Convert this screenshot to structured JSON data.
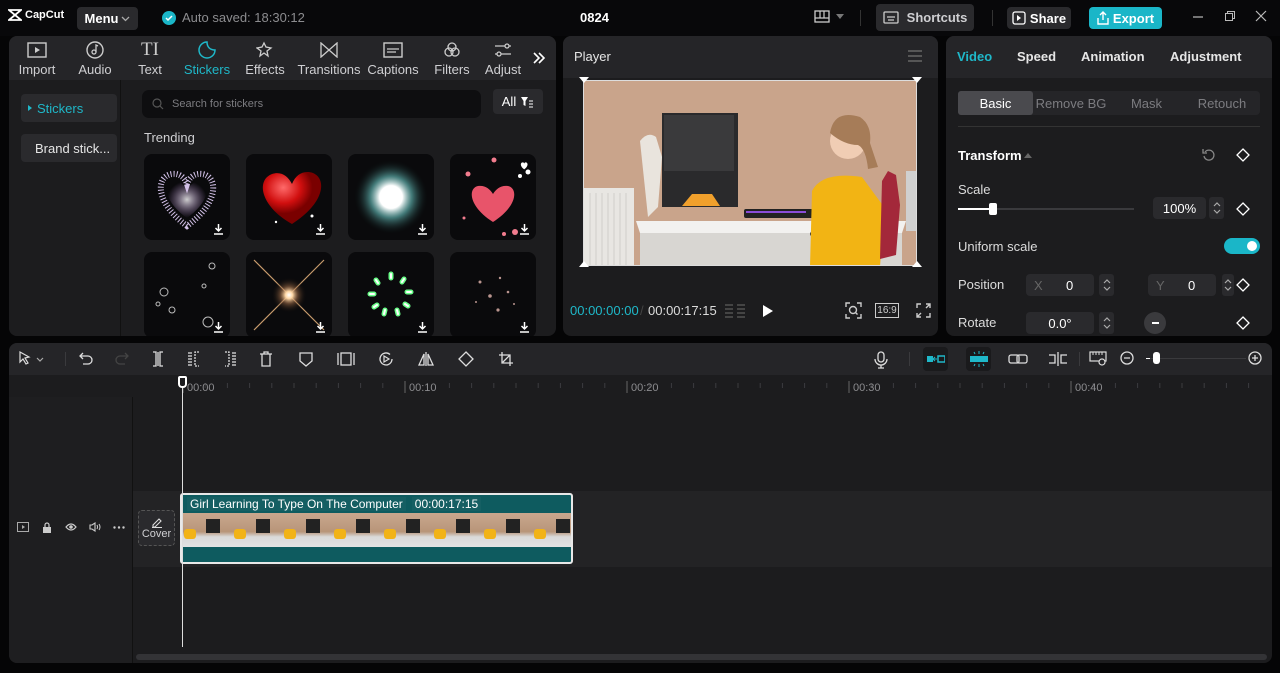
{
  "titlebar": {
    "app_name": "CapCut",
    "menu_label": "Menu",
    "autosave_text": "Auto saved: 18:30:12",
    "project_title": "0824",
    "shortcuts_label": "Shortcuts",
    "share_label": "Share",
    "export_label": "Export",
    "accent_color": "#1ab6c8"
  },
  "media_panel": {
    "tabs": [
      {
        "label": "Import",
        "icon": "import-icon"
      },
      {
        "label": "Audio",
        "icon": "audio-icon"
      },
      {
        "label": "Text",
        "icon": "text-icon"
      },
      {
        "label": "Stickers",
        "icon": "stickers-icon",
        "active": true
      },
      {
        "label": "Effects",
        "icon": "effects-icon"
      },
      {
        "label": "Transitions",
        "icon": "transitions-icon"
      },
      {
        "label": "Captions",
        "icon": "captions-icon"
      },
      {
        "label": "Filters",
        "icon": "filters-icon"
      },
      {
        "label": "Adjust",
        "icon": "adjust-icon"
      }
    ],
    "sidebar": [
      {
        "label": "Stickers",
        "active": true
      },
      {
        "label": "Brand stick..."
      }
    ],
    "search_placeholder": "Search for stickers",
    "filter_label": "All",
    "section_title": "Trending",
    "stickers": [
      {
        "name": "sparkle-heart"
      },
      {
        "name": "red-3d-heart"
      },
      {
        "name": "white-burst"
      },
      {
        "name": "pink-hearts"
      },
      {
        "name": "bubble-hearts"
      },
      {
        "name": "light-flare"
      },
      {
        "name": "green-firework"
      },
      {
        "name": "glitter-stars"
      }
    ]
  },
  "player": {
    "title": "Player",
    "current_time": "00:00:00:00",
    "total_time": "00:00:17:15",
    "aspect_ratio": "16:9"
  },
  "inspector": {
    "tabs": [
      {
        "label": "Video",
        "active": true
      },
      {
        "label": "Speed"
      },
      {
        "label": "Animation"
      },
      {
        "label": "Adjustment"
      }
    ],
    "subtabs": [
      {
        "label": "Basic",
        "active": true
      },
      {
        "label": "Remove BG"
      },
      {
        "label": "Mask"
      },
      {
        "label": "Retouch"
      }
    ],
    "section_title": "Transform",
    "scale_label": "Scale",
    "scale_value": "100%",
    "scale_slider_fraction": 0.2,
    "uniform_scale_label": "Uniform scale",
    "uniform_scale_on": true,
    "position_label": "Position",
    "position_x_label": "X",
    "position_x": "0",
    "position_y_label": "Y",
    "position_y": "0",
    "rotate_label": "Rotate",
    "rotate_value": "0.0°"
  },
  "timeline": {
    "ruler_labels": [
      "00:00",
      "00:10",
      "00:20",
      "00:30",
      "00:40"
    ],
    "clip_title": "Girl Learning To Type On The Computer",
    "clip_duration": "00:00:17:15",
    "cover_label": "Cover",
    "zoom_fraction": 0.1
  }
}
